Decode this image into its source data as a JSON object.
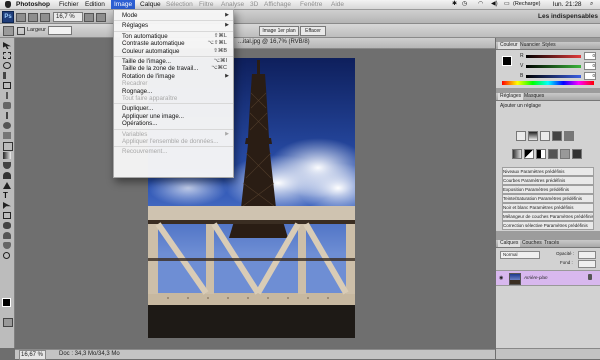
{
  "menubar": {
    "app_name": "Photoshop",
    "items": [
      "Fichier",
      "Edition",
      "Image",
      "Calque",
      "Sélection",
      "Filtre",
      "Analyse",
      "3D",
      "Affichage",
      "Fenêtre",
      "Aide"
    ],
    "active_item": "Image",
    "clock": "lun. 21:28",
    "battery": "(Recharge)"
  },
  "appbar": {
    "logo": "Ps",
    "zoom": "16,7 %",
    "workspace": "Les indispensables"
  },
  "optionsbar": {
    "width_label": "Largeur :",
    "image_button": "Image 1er plan",
    "clear_button": "Effacer"
  },
  "document": {
    "tab_title": "...ital.jpg @ 16,7% (RVB/8)"
  },
  "statusbar": {
    "zoom": "16,67 %",
    "doc_info": "Doc : 34,3 Mo/34,3 Mo"
  },
  "image_menu": {
    "items": [
      {
        "label": "Mode",
        "shortcut": "",
        "submenu": true,
        "disabled": false
      },
      {
        "separator": true
      },
      {
        "label": "Réglages",
        "shortcut": "",
        "submenu": true,
        "disabled": false
      },
      {
        "separator": true
      },
      {
        "label": "Ton automatique",
        "shortcut": "⇧⌘L",
        "submenu": false,
        "disabled": false
      },
      {
        "label": "Contraste automatique",
        "shortcut": "⌥⇧⌘L",
        "submenu": false,
        "disabled": false
      },
      {
        "label": "Couleur automatique",
        "shortcut": "⇧⌘B",
        "submenu": false,
        "disabled": false
      },
      {
        "separator": true
      },
      {
        "label": "Taille de l'image...",
        "shortcut": "⌥⌘I",
        "submenu": false,
        "disabled": false
      },
      {
        "label": "Taille de la zone de travail...",
        "shortcut": "⌥⌘C",
        "submenu": false,
        "disabled": false
      },
      {
        "label": "Rotation de l'image",
        "shortcut": "",
        "submenu": true,
        "disabled": false
      },
      {
        "label": "Recadrer",
        "shortcut": "",
        "submenu": false,
        "disabled": true
      },
      {
        "label": "Rognage...",
        "shortcut": "",
        "submenu": false,
        "disabled": false
      },
      {
        "label": "Tout faire apparaître",
        "shortcut": "",
        "submenu": false,
        "disabled": true
      },
      {
        "separator": true
      },
      {
        "label": "Dupliquer...",
        "shortcut": "",
        "submenu": false,
        "disabled": false
      },
      {
        "label": "Appliquer une image...",
        "shortcut": "",
        "submenu": false,
        "disabled": false
      },
      {
        "label": "Opérations...",
        "shortcut": "",
        "submenu": false,
        "disabled": false
      },
      {
        "separator": true
      },
      {
        "label": "Variables",
        "shortcut": "",
        "submenu": true,
        "disabled": true
      },
      {
        "label": "Appliquer l'ensemble de données...",
        "shortcut": "",
        "submenu": false,
        "disabled": true
      },
      {
        "separator": true
      },
      {
        "label": "Recouvrement...",
        "shortcut": "",
        "submenu": false,
        "disabled": true
      }
    ]
  },
  "color_panel": {
    "tabs": [
      "Couleur",
      "Nuancier",
      "Styles"
    ],
    "channels": [
      "R",
      "V",
      "B"
    ],
    "values": [
      "0",
      "0",
      "0"
    ],
    "channel_colors": [
      "#e23b3b",
      "#3bb53b",
      "#3b5fe2"
    ]
  },
  "adjust_panel": {
    "tabs": [
      "Réglages",
      "Masques"
    ],
    "heading": "Ajouter un réglage",
    "presets": [
      "Niveaux Paramètres prédéfinis",
      "Courbes Paramètres prédéfinis",
      "Exposition Paramètres prédéfinis",
      "Teinte/Saturation Paramètres prédéfinis",
      "Noir et blanc Paramètres prédéfinis",
      "Mélangeur de couches Paramètres prédéfinis",
      "Correction sélective Paramètres prédéfinis"
    ]
  },
  "layers_panel": {
    "tabs": [
      "Calques",
      "Couches",
      "Tracés"
    ],
    "blend_mode": "Normal",
    "opacity_label": "Opacité :",
    "fill_label": "Fond :",
    "layer_name": "Arrière-plan",
    "selected_layer_color": "#d8b8ee"
  }
}
